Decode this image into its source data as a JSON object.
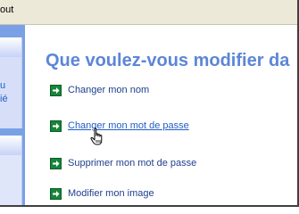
{
  "menubar": {
    "item": "out"
  },
  "sidebar": {
    "line1": "u",
    "line2": "ié"
  },
  "main": {
    "heading": "Que voulez-vous modifier da",
    "tasks": [
      {
        "label": "Changer mon nom",
        "icon": "green-arrow-icon"
      },
      {
        "label": "Changer mon mot de passe",
        "icon": "green-arrow-icon",
        "state": "hover"
      },
      {
        "label": "Supprimer mon mot de passe",
        "icon": "green-arrow-icon"
      },
      {
        "label": "Modifier mon image",
        "icon": "green-arrow-icon"
      }
    ]
  },
  "cursor": {
    "icon": "hand-pointer-icon"
  },
  "colors": {
    "heading": "#5c86d7",
    "link": "#1f3f8c",
    "link_hover": "#215dc6",
    "arrow": "#16853b",
    "sidebar": "#7aa1e6"
  }
}
